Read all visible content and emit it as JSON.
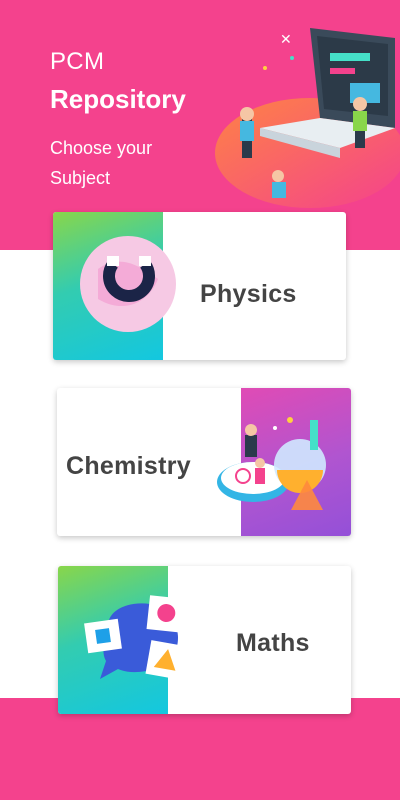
{
  "header": {
    "title_light": "PCM",
    "title_bold": "Repository",
    "subtitle": "Choose your Subject"
  },
  "subjects": [
    {
      "label": "Physics"
    },
    {
      "label": "Chemistry"
    },
    {
      "label": "Maths"
    }
  ],
  "colors": {
    "brand_pink": "#f4428d",
    "card_text": "#444444",
    "green_gradient": [
      "#89d64a",
      "#13c7e0"
    ],
    "purple_gradient": [
      "#e04bb5",
      "#9450d8"
    ]
  },
  "icons": {
    "hero": "laptop-people-illustration",
    "physics": "magnet-icon",
    "chemistry": "lab-flask-illustration",
    "maths": "shapes-chat-icon"
  }
}
